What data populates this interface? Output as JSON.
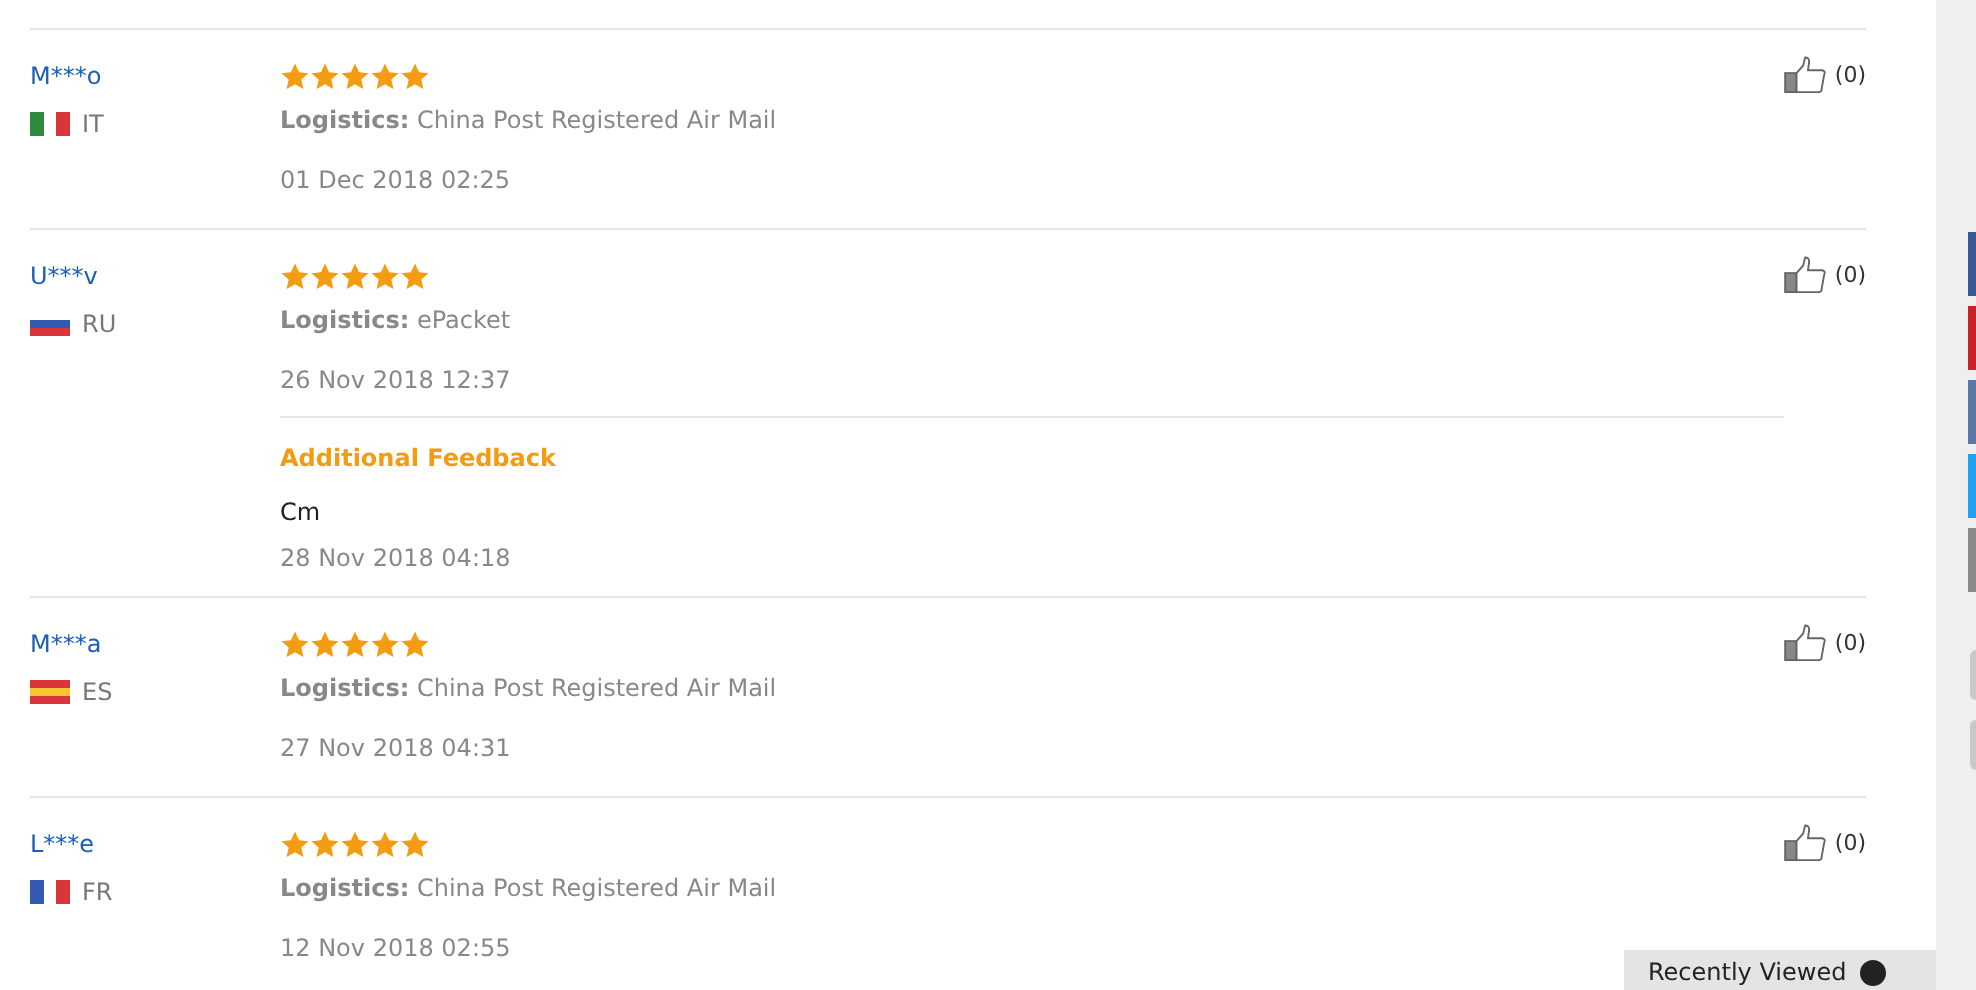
{
  "reviews": [
    {
      "user": "M***o",
      "country": "IT",
      "kind": "vertical",
      "flag": [
        {
          "color": "#2e8b3e"
        },
        {
          "color": "#ffffff"
        },
        {
          "color": "#d9343a"
        }
      ],
      "stars": 5,
      "logistics_label": "Logistics:",
      "logistics": "China Post Registered Air Mail",
      "date": "01 Dec 2018 02:25",
      "likes": "(0)"
    },
    {
      "user": "U***v",
      "country": "RU",
      "kind": "horizontal",
      "flag": [
        {
          "color": "#ffffff"
        },
        {
          "color": "#3558b0"
        },
        {
          "color": "#d9343a"
        }
      ],
      "stars": 5,
      "logistics_label": "Logistics:",
      "logistics": "ePacket",
      "date": "26 Nov 2018 12:37",
      "likes": "(0)",
      "additional": {
        "title": "Additional Feedback",
        "text": "Cm",
        "date": "28 Nov 2018 04:18"
      }
    },
    {
      "user": "M***a",
      "country": "ES",
      "kind": "horizontal",
      "flag": [
        {
          "color": "#d9343a"
        },
        {
          "color": "#f6c530"
        },
        {
          "color": "#d9343a"
        }
      ],
      "stars": 5,
      "logistics_label": "Logistics:",
      "logistics": "China Post Registered Air Mail",
      "date": "27 Nov 2018 04:31",
      "likes": "(0)"
    },
    {
      "user": "L***e",
      "country": "FR",
      "kind": "vertical",
      "flag": [
        {
          "color": "#3558b0"
        },
        {
          "color": "#ffffff"
        },
        {
          "color": "#d9343a"
        }
      ],
      "stars": 5,
      "logistics_label": "Logistics:",
      "logistics": "China Post Registered Air Mail",
      "date": "12 Nov 2018 02:55",
      "likes": "(0)"
    }
  ],
  "share_buttons": [
    {
      "color": "#3b5998"
    },
    {
      "color": "#cb2027"
    },
    {
      "color": "#5a77a8"
    },
    {
      "color": "#1da1f2"
    },
    {
      "color": "#8a8a8a"
    }
  ],
  "recently_viewed": {
    "label": "Recently Viewed"
  }
}
